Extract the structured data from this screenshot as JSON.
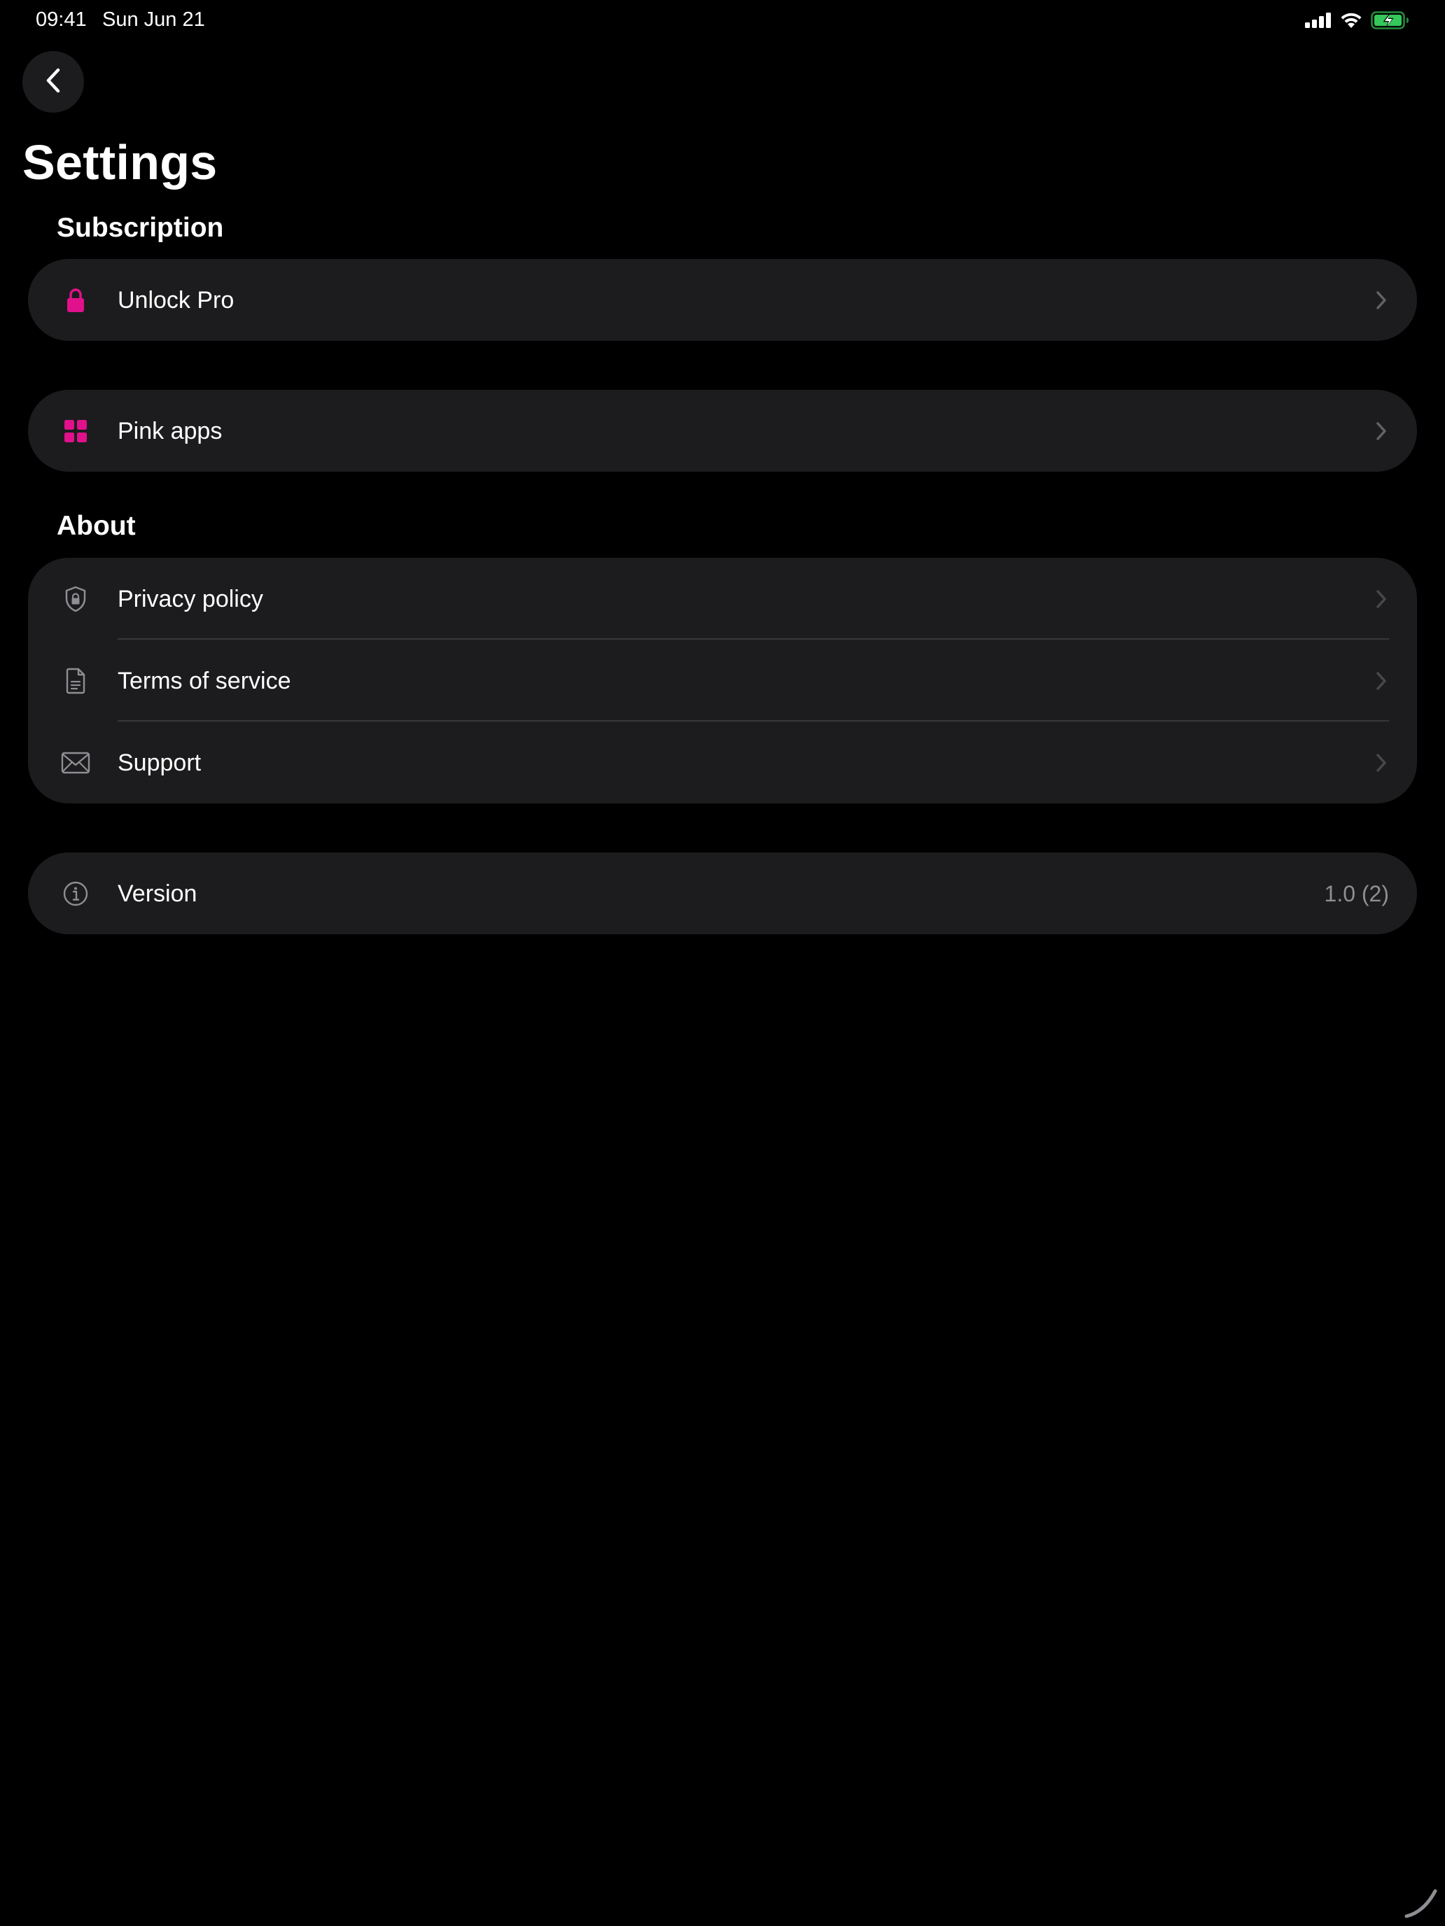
{
  "status_bar": {
    "time": "09:41",
    "date": "Sun Jun 21",
    "icons": [
      "cellular-signal-icon",
      "wifi-icon",
      "battery-charging-icon"
    ]
  },
  "header": {
    "back_icon": "chevron-left-icon",
    "title": "Settings"
  },
  "sections": {
    "subscription": {
      "header": "Subscription",
      "items": [
        {
          "label": "Unlock Pro",
          "icon": "lock-icon"
        }
      ]
    },
    "apps": {
      "items": [
        {
          "label": "Pink apps",
          "icon": "grid-icon"
        }
      ]
    },
    "about": {
      "header": "About",
      "items": [
        {
          "label": "Privacy policy",
          "icon": "shield-lock-icon"
        },
        {
          "label": "Terms of service",
          "icon": "document-icon"
        },
        {
          "label": "Support",
          "icon": "envelope-icon"
        }
      ]
    },
    "version": {
      "items": [
        {
          "label": "Version",
          "icon": "info-icon",
          "value": "1.0 (2)"
        }
      ]
    }
  },
  "colors": {
    "background": "#000000",
    "card": "#1c1c1e",
    "accent_pink": "#e0118a",
    "secondary_text": "#8e8e93",
    "chevron": "#636366",
    "battery_green": "#34c759"
  }
}
